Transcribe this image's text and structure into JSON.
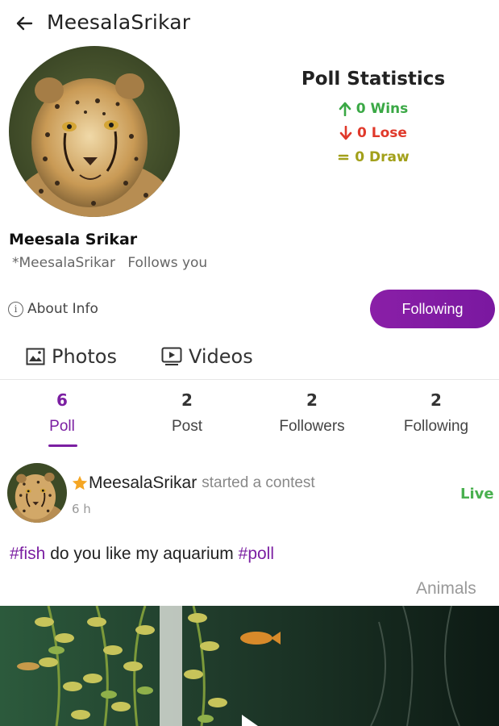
{
  "header": {
    "title": "MeesalaSrikar",
    "back_icon": "arrow-left-icon"
  },
  "profile": {
    "display_name": "Meesala Srikar",
    "handle": "*MeesalaSrikar",
    "follows_you": "Follows you",
    "about_label": "About Info",
    "follow_button": "Following"
  },
  "poll_statistics": {
    "title": "Poll Statistics",
    "wins": "0 Wins",
    "lose": "0 Lose",
    "draw": "0 Draw",
    "colors": {
      "wins": "#3aa845",
      "lose": "#e0392b",
      "draw": "#a2a01a"
    }
  },
  "media_tabs": [
    {
      "label": "Photos",
      "icon": "image-icon"
    },
    {
      "label": "Videos",
      "icon": "video-icon"
    }
  ],
  "counts": [
    {
      "value": "6",
      "label": "Poll",
      "active": true
    },
    {
      "value": "2",
      "label": "Post",
      "active": false
    },
    {
      "value": "2",
      "label": "Followers",
      "active": false
    },
    {
      "value": "2",
      "label": "Following",
      "active": false
    }
  ],
  "post": {
    "author": "MeesalaSrikar",
    "action": "started a contest",
    "time": "6 h",
    "status": "Live",
    "hashtag1": "#fish",
    "text": " do you like my aquarium ",
    "hashtag2": "#poll",
    "category": "Animals"
  },
  "accent_color": "#7b1fa2"
}
